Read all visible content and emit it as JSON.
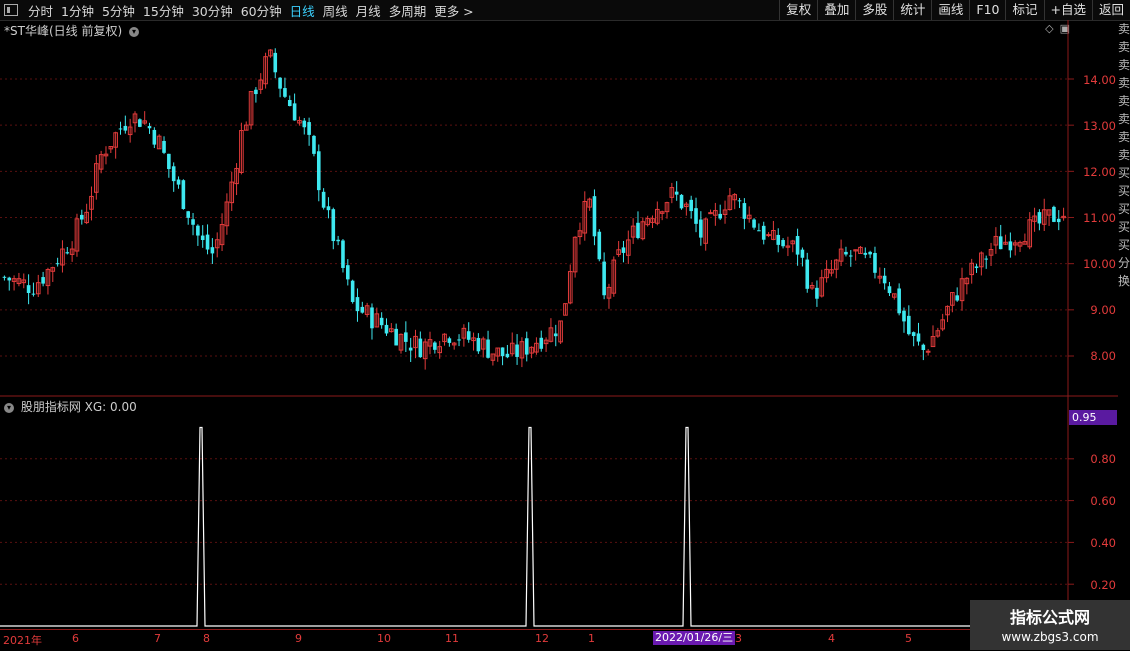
{
  "toolbar": {
    "periods": [
      "分时",
      "1分钟",
      "5分钟",
      "15分钟",
      "30分钟",
      "60分钟",
      "日线",
      "周线",
      "月线",
      "多周期",
      "更多 >"
    ],
    "active_period": "日线",
    "right_buttons": [
      "复权",
      "叠加",
      "多股",
      "统计",
      "画线",
      "F10",
      "标记",
      "+自选",
      "返回"
    ]
  },
  "main_panel": {
    "title": "*ST华峰(日线 前复权)",
    "y_labels": [
      "14.00",
      "13.00",
      "12.00",
      "11.00",
      "10.00",
      "9.00",
      "8.00"
    ]
  },
  "indicator_panel": {
    "title": "股朋指标网 XG: 0.00",
    "current_value": "0.95",
    "y_labels": [
      "0.80",
      "0.60",
      "0.40",
      "0.20"
    ]
  },
  "date_axis": {
    "labels": [
      "2021年",
      "6",
      "7",
      "8",
      "9",
      "10",
      "11",
      "12",
      "1",
      "3",
      "4",
      "5"
    ],
    "highlight": "2022/01/26/三"
  },
  "right_strip_text": "卖卖卖卖卖卖卖卖买买买买买分换",
  "watermark": {
    "line1": "指标公式网",
    "line2": "www.zbgs3.com"
  },
  "colors": {
    "up": "#e23b3b",
    "down": "#3ee8f0",
    "signal": "#ffffff",
    "grid": "#5a1010"
  },
  "chart_data": [
    {
      "type": "candlestick",
      "title": "*ST华峰(日线 前复权)",
      "ylim": [
        7.2,
        15.0
      ],
      "close_path": [
        9.7,
        9.6,
        9.5,
        9.8,
        10.2,
        10.6,
        11.3,
        12.4,
        12.8,
        13.2,
        13.1,
        12.7,
        11.9,
        11.3,
        10.5,
        10.2,
        11.3,
        12.8,
        13.8,
        14.5,
        13.7,
        13.2,
        12.5,
        11.2,
        10.2,
        9.1,
        8.9,
        8.7,
        8.5,
        8.3,
        8.2,
        8.4,
        8.5,
        8.4,
        8.3,
        8.1,
        8.0,
        8.1,
        8.3,
        8.5,
        8.7,
        10.8,
        11.3,
        9.2,
        10.1,
        10.6,
        11.0,
        11.3,
        11.5,
        11.2,
        10.6,
        11.0,
        11.5,
        11.2,
        10.8,
        10.5,
        10.4,
        10.3,
        9.3,
        9.7,
        10.1,
        10.2,
        10.0,
        9.8,
        9.2,
        8.4,
        8.1,
        8.6,
        9.2,
        9.7,
        10.0,
        10.4,
        10.5,
        10.7,
        10.8,
        11.0,
        11.1
      ]
    },
    {
      "type": "line",
      "series": [
        {
          "name": "XG",
          "values": [
            0,
            0,
            0,
            0,
            0,
            0,
            0,
            0,
            0,
            0,
            0,
            0,
            0,
            0,
            0,
            0,
            0,
            0,
            0,
            0,
            0,
            0,
            0,
            0,
            0,
            0,
            0,
            0,
            0,
            0,
            0,
            0,
            0,
            0,
            0,
            0,
            0,
            0,
            0,
            0,
            0,
            0,
            0,
            0,
            0,
            0,
            0,
            0,
            0,
            0,
            0,
            0,
            0,
            0,
            0,
            0,
            0,
            0,
            0,
            0,
            0,
            0,
            0,
            0,
            0,
            0,
            0,
            0,
            0,
            0,
            0,
            0,
            0,
            0,
            0,
            0,
            0
          ]
        }
      ],
      "spikes_at": [
        201,
        530,
        687
      ],
      "ylim": [
        0,
        1.0
      ]
    }
  ]
}
